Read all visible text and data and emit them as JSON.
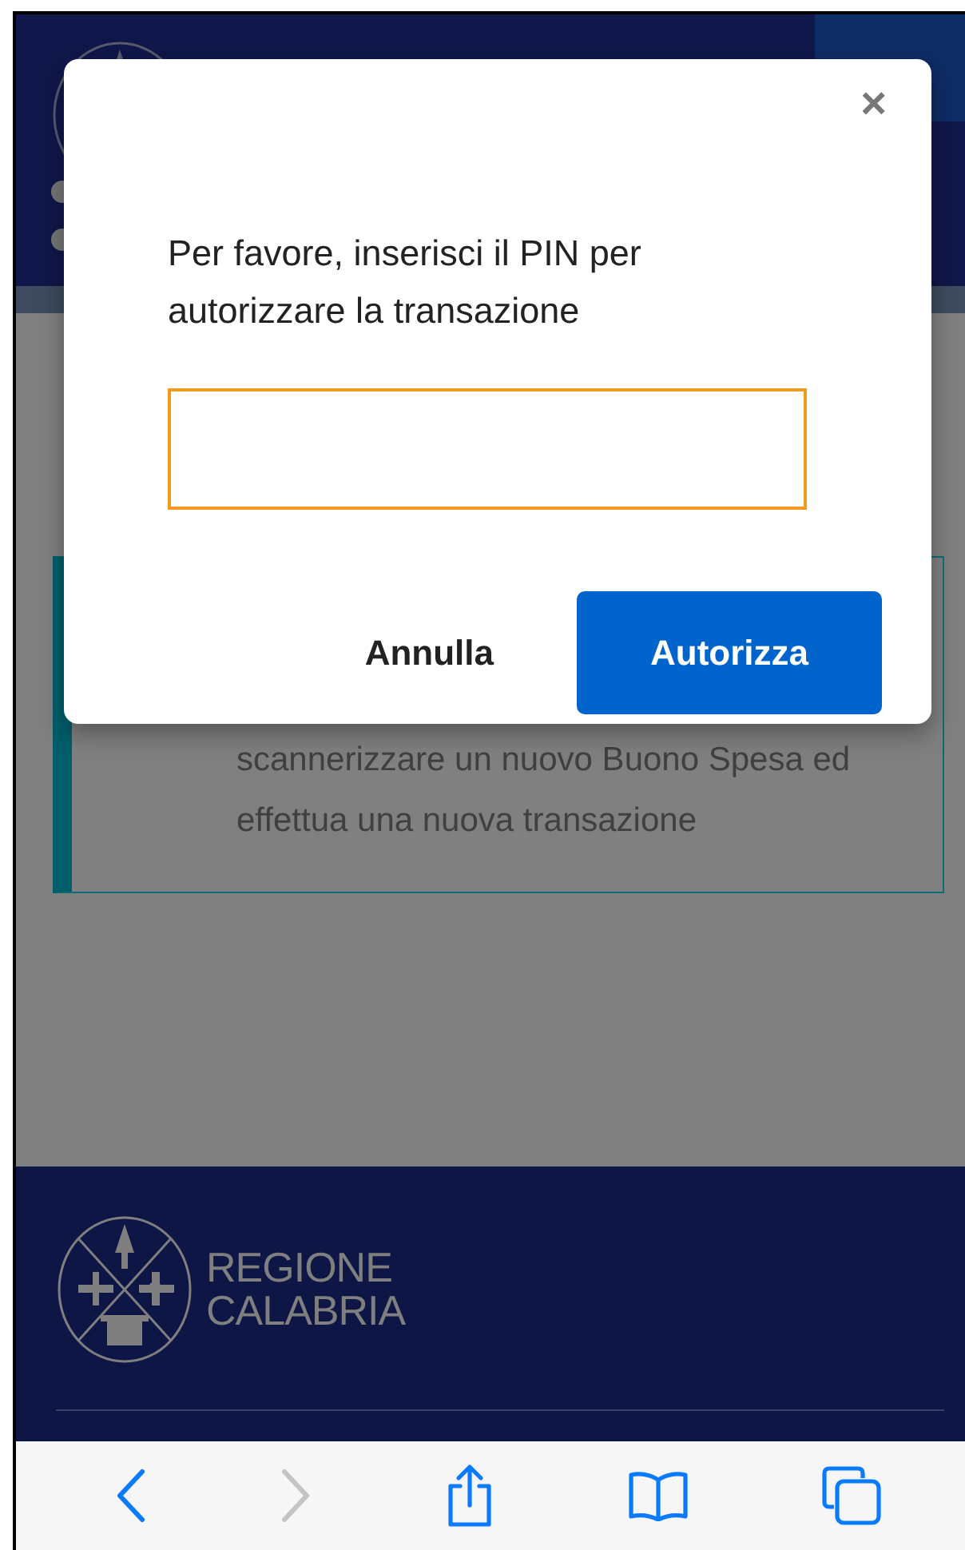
{
  "card": {
    "text": "scannerizzare un nuovo Buono Spesa ed effettua una nuova transazione"
  },
  "footer": {
    "logo_lines": [
      "REGIONE",
      "CALABRIA"
    ]
  },
  "modal": {
    "close": "×",
    "message": "Per favore, inserisci il PIN per autorizzare la transazione",
    "pin_field": {
      "focused": true
    },
    "buttons": [
      {
        "label": "Annulla",
        "kind": "text"
      },
      {
        "label": "Autorizza",
        "kind": "primary"
      }
    ]
  },
  "toolbar": [
    {
      "kind": "back",
      "disabled": false
    },
    {
      "kind": "forward",
      "disabled": true
    },
    {
      "kind": "share",
      "disabled": false
    },
    {
      "kind": "bookmarks",
      "disabled": false
    },
    {
      "kind": "tabs",
      "disabled": false
    }
  ]
}
